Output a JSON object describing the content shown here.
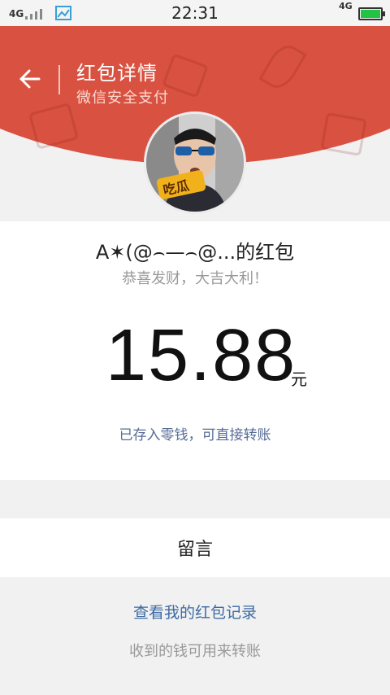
{
  "status_bar": {
    "network_left": "4G",
    "time": "22:31",
    "network_right": "4G",
    "battery_color": "#23c343"
  },
  "header": {
    "title": "红包详情",
    "subtitle": "微信安全支付",
    "back_icon": "arrow-left-icon",
    "background_color": "#d95140"
  },
  "packet": {
    "sender": "A✶(@⌢—⌢@...的红包",
    "wish": "恭喜发财，大吉大利！",
    "amount": "15.88",
    "unit": "元",
    "note": "已存入零钱，可直接转账"
  },
  "message": {
    "label": "留言"
  },
  "footer": {
    "records_link": "查看我的红包记录",
    "tip": "收到的钱可用来转账"
  }
}
